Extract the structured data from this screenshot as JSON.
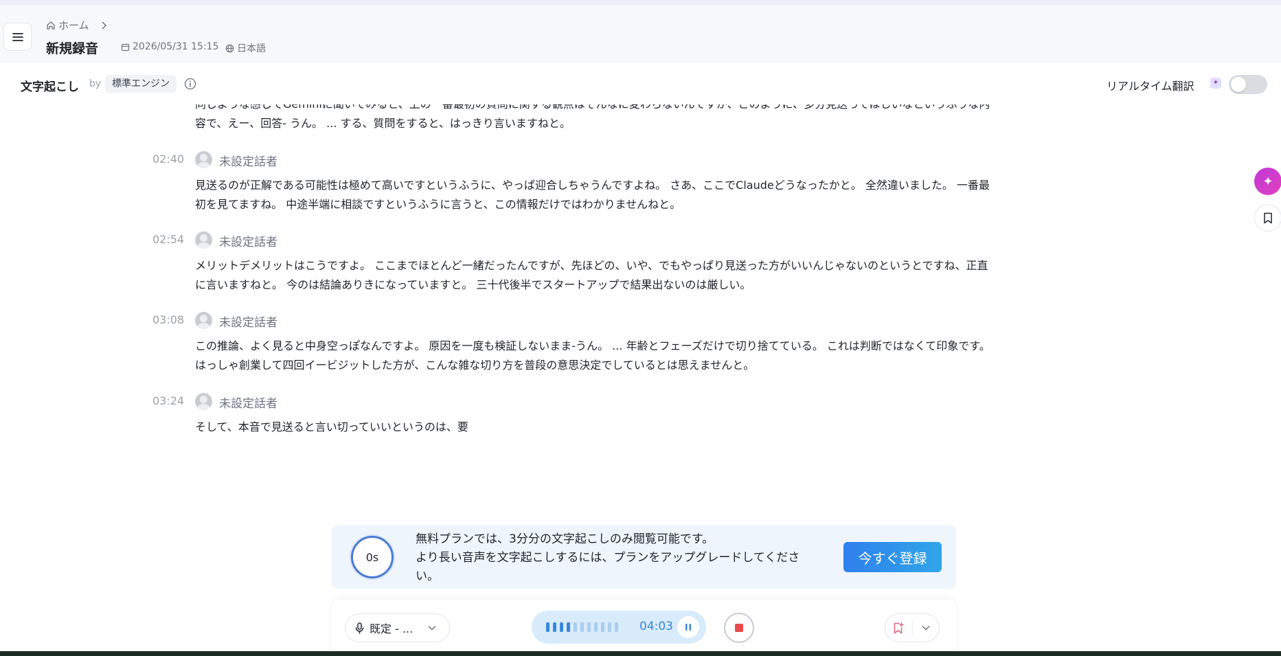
{
  "header": {
    "breadcrumb_home": "ホーム",
    "title": "新規録音",
    "datetime": "2026/05/31 15:15",
    "language": "日本語"
  },
  "transcript_bar": {
    "title": "文字起こし",
    "by": "by",
    "engine": "標準エンジン",
    "realtime_translation": "リアルタイム翻訳",
    "realtime_enabled": false
  },
  "segments": {
    "partial_top": {
      "line1": "同じような感じでGeminiに聞いてみると、上の一番最初の質問に関する観点はそんなに変わらないんですが、このように、多分見送ってほしいなというふうな内",
      "line2": "容で、えー、回答- うん。 ... する、質問をすると、はっきり言いますねと。"
    },
    "items": [
      {
        "time": "02:40",
        "speaker": "未設定話者",
        "line1": "見送るのが正解である可能性は極めて高いですというふうに、やっぱ迎合しちゃうんですよね。 さあ、ここでClaudeどうなったかと。 全然違いました。 一番最",
        "line2": "初を見てますね。 中途半端に相談ですというふうに言うと、この情報だけではわかりませんねと。"
      },
      {
        "time": "02:54",
        "speaker": "未設定話者",
        "line1": "メリットデメリットはこうですよ。 ここまでほとんど一緒だったんですが、先ほどの、いや、でもやっぱり見送った方がいいんじゃないのというとですね、正直",
        "line2": "に言いますねと。 今のは結論ありきになっていますと。 三十代後半でスタートアップで結果出ないのは厳しい。"
      },
      {
        "time": "03:08",
        "speaker": "未設定話者",
        "line1": "この推論、よく見ると中身空っぽなんですよ。 原因を一度も検証しないまま-うん。 ... 年齢とフェーズだけで切り捨てている。 これは判断ではなくて印象です。",
        "line2": "はっしゃ創業して四回イービジットした方が、こんな雑な切り方を普段の意思決定でしているとは思えませんと。"
      },
      {
        "time": "03:24",
        "speaker": "未設定話者",
        "line1": "そして、本音で見送ると言い切っていいというのは、要",
        "line2": ""
      }
    ]
  },
  "banner": {
    "timer": "0s",
    "line1": "無料プランでは、3分分の文字起こしのみ閲覧可能です。",
    "line2": "より長い音声を文字起こしするには、プランをアップグレードしてくださ",
    "line3": "い。",
    "button": "今すぐ登録"
  },
  "controls": {
    "mic_label": "既定 - ...",
    "elapsed": "04:03",
    "level_fraction": 0.36
  },
  "colors": {
    "accent": "#2f80ed",
    "record_level": "#3a87d9",
    "record_level_inactive": "#a9cdef",
    "stop": "#e94a4a",
    "ai_button": "#d23ccb"
  }
}
